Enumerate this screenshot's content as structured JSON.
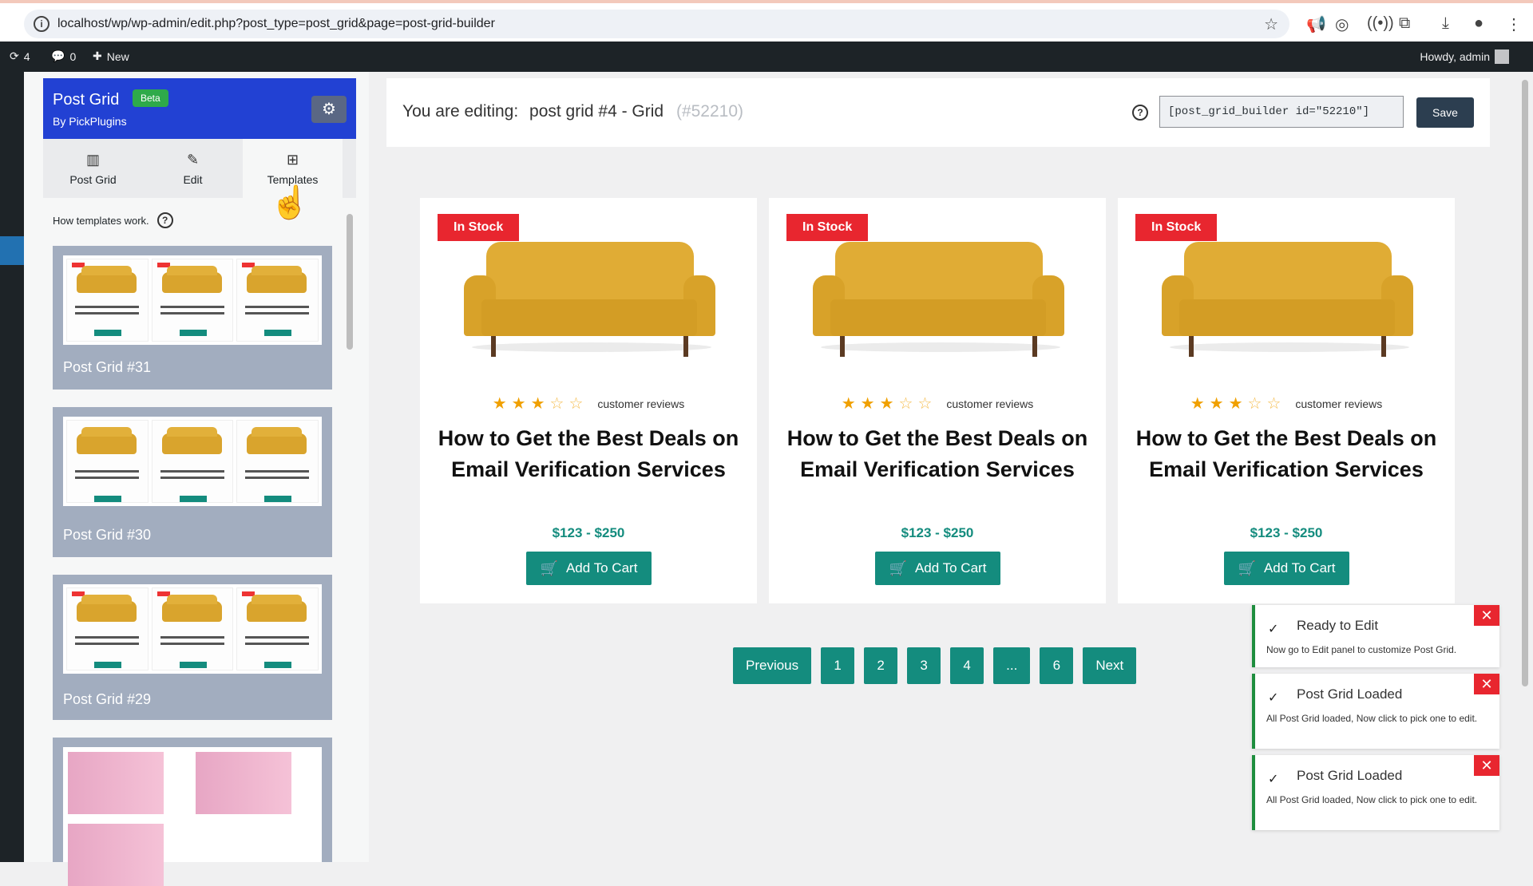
{
  "browser": {
    "url": "localhost/wp/wp-admin/edit.php?post_type=post_grid&page=post-grid-builder"
  },
  "admin_bar": {
    "updates_count": "4",
    "comments_count": "0",
    "new_label": "New",
    "howdy": "Howdy, admin"
  },
  "sidebar": {
    "title": "Post Grid",
    "badge": "Beta",
    "author": "By PickPlugins",
    "tabs": [
      {
        "label": "Post Grid",
        "icon": "grid-columns-icon"
      },
      {
        "label": "Edit",
        "icon": "pencil-icon"
      },
      {
        "label": "Templates",
        "icon": "templates-icon"
      }
    ],
    "help_text": "How templates work.",
    "templates": [
      {
        "name": "Post Grid #31"
      },
      {
        "name": "Post Grid #30"
      },
      {
        "name": "Post Grid #29"
      }
    ]
  },
  "editor": {
    "editing_prefix": "You are editing:",
    "grid_name": "post grid #4 - Grid",
    "grid_id": "(#52210)",
    "shortcode": "[post_grid_builder id=\"52210\"]",
    "save_label": "Save"
  },
  "products": [
    {
      "badge": "In Stock",
      "reviews": "customer reviews",
      "rating": 3,
      "title": "How to Get the Best Deals on Email Verification Services",
      "price": "$123  -  $250",
      "cart_label": "Add To Cart"
    },
    {
      "badge": "In Stock",
      "reviews": "customer reviews",
      "rating": 3,
      "title": "How to Get the Best Deals on Email Verification Services",
      "price": "$123  -  $250",
      "cart_label": "Add To Cart"
    },
    {
      "badge": "In Stock",
      "reviews": "customer reviews",
      "rating": 3,
      "title": "How to Get the Best Deals on Email Verification Services",
      "price": "$123  -  $250",
      "cart_label": "Add To Cart"
    }
  ],
  "pagination": {
    "previous": "Previous",
    "pages": [
      "1",
      "2",
      "3",
      "4",
      "...",
      "6"
    ],
    "next": "Next"
  },
  "toasts": [
    {
      "title": "Ready to Edit",
      "body": "Now go to Edit panel to customize Post Grid."
    },
    {
      "title": "Post Grid Loaded",
      "body": "All Post Grid loaded, Now click to pick one to edit."
    },
    {
      "title": "Post Grid Loaded",
      "body": "All Post Grid loaded, Now click to pick one to edit."
    }
  ],
  "colors": {
    "accent_blue": "#2241d3",
    "teal": "#148c7e",
    "stock_red": "#e8262f",
    "admin_dark": "#1d2327"
  }
}
